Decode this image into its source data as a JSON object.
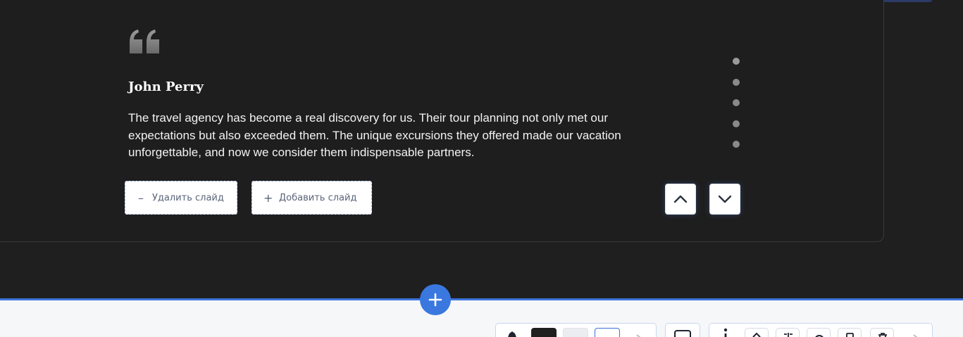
{
  "testimonial": {
    "author": "John Perry",
    "text": "The travel agency has become a real discovery for us. Their tour planning not only met our expectations but also exceeded them. The unique excursions they offered made our vacation unforgettable, and now we consider them indispensable partners.",
    "slide_count": 5,
    "active_slide": 1
  },
  "editor": {
    "remove_slide_label": "Удалить слайд",
    "add_slide_label": "Добавить слайд",
    "remove_glyph": "–",
    "add_glyph": "+"
  },
  "colors": {
    "section_bg": "#1f1f1f",
    "accent": "#3a78e0",
    "divider": "#3b72d9",
    "text": "#f2f2f2"
  },
  "toolbar": {
    "icons": [
      "palette-icon",
      "color-swatch-dark",
      "color-swatch-light",
      "color-swatch-white",
      "arrow-icon",
      "image-icon",
      "more-vertical-icon",
      "move-up-icon",
      "columns-icon",
      "circle-icon",
      "copy-icon",
      "delete-icon",
      "arrow-icon"
    ]
  }
}
